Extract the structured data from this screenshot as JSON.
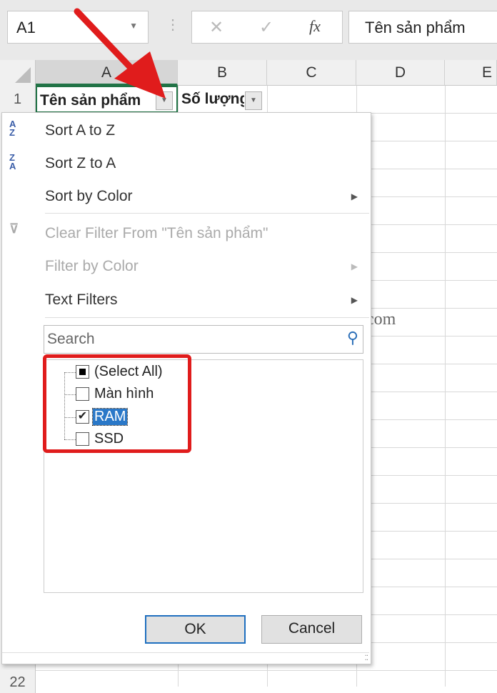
{
  "namebox": {
    "value": "A1"
  },
  "formula_bar": {
    "cancel_icon": "✕",
    "enter_icon": "✓",
    "fx_label": "fx",
    "value": "Tên sản phẩm"
  },
  "columns": [
    "A",
    "B",
    "C",
    "D",
    "E"
  ],
  "rows": [
    "1",
    "22"
  ],
  "cells": {
    "A1": "Tên sản phẩm",
    "B1": "Số lượng"
  },
  "menu": {
    "sort_az": "Sort A to Z",
    "sort_za": "Sort Z to A",
    "sort_color": "Sort by Color",
    "clear_filter": "Clear Filter From \"Tên sản phẩm\"",
    "filter_color": "Filter by Color",
    "text_filters": "Text Filters",
    "search_placeholder": "Search",
    "items": [
      {
        "label": "(Select All)",
        "state": "indeterminate"
      },
      {
        "label": "Màn hình",
        "state": "unchecked"
      },
      {
        "label": "RAM",
        "state": "checked"
      },
      {
        "label": "SSD",
        "state": "unchecked"
      }
    ],
    "ok": "OK",
    "cancel": "Cancel"
  },
  "watermark": ".com",
  "annotation_color": "#e01c1c"
}
